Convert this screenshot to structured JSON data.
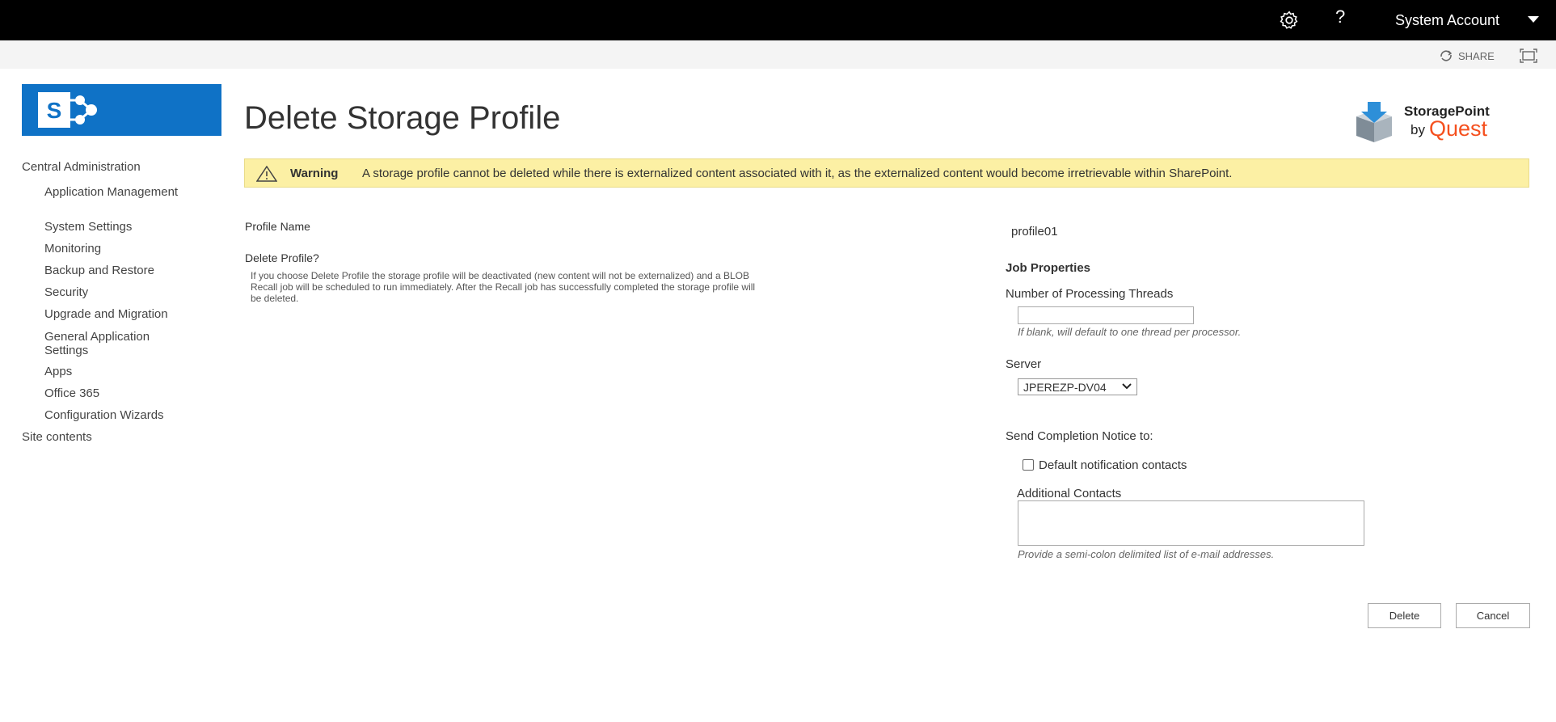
{
  "suitebar": {
    "help_label": "?",
    "account_name": "System Account",
    "icons": [
      "gear-icon",
      "help-icon",
      "chevron-down-icon"
    ]
  },
  "ribbon": {
    "share_label": "SHARE"
  },
  "page": {
    "title": "Delete Storage Profile"
  },
  "brand": {
    "product": "StoragePoint",
    "by": "by",
    "company": "Quest",
    "quest_color": "#f5501e"
  },
  "nav": {
    "root": "Central Administration",
    "items": [
      "Application Management",
      "System Settings",
      "Monitoring",
      "Backup and Restore",
      "Security",
      "Upgrade and Migration",
      "General Application Settings",
      "Apps",
      "Office 365",
      "Configuration Wizards"
    ],
    "site_contents": "Site contents"
  },
  "warning": {
    "label": "Warning",
    "text": "A storage profile cannot be deleted while there is externalized content associated with it, as the externalized content would become irretrievable within SharePoint.",
    "bg_color": "#fcf0a4"
  },
  "form": {
    "profile_name_label": "Profile Name",
    "profile_name_value": "profile01",
    "delete_profile_label": "Delete Profile?",
    "delete_profile_desc": "If you choose Delete Profile the storage profile will be deactivated (new content will not be externalized) and a BLOB Recall job will be scheduled to run immediately. After the Recall job has successfully completed the storage profile will be deleted.",
    "job_properties_heading": "Job Properties",
    "threads_label": "Number of Processing Threads",
    "threads_value": "",
    "threads_hint": "If blank, will default to one thread per processor.",
    "server_label": "Server",
    "server_value": "JPEREZP-DV04",
    "completion_label": "Send Completion Notice to:",
    "default_contacts_label": "Default notification contacts",
    "default_contacts_checked": false,
    "additional_contacts_label": "Additional Contacts",
    "additional_contacts_value": "",
    "additional_contacts_hint": "Provide a semi-colon delimited list of e-mail addresses."
  },
  "buttons": {
    "delete": "Delete",
    "cancel": "Cancel"
  },
  "colors": {
    "suitebar": "#000000",
    "brand_blue": "#0f72c6"
  }
}
